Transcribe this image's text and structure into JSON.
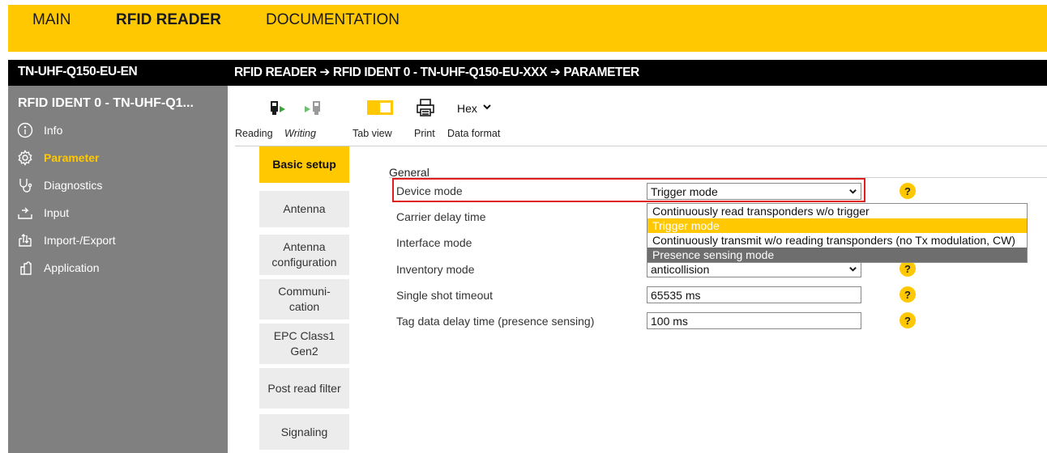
{
  "topnav": {
    "main": "MAIN",
    "rfid": "RFID READER",
    "docs": "DOCUMENTATION"
  },
  "header": {
    "device": "TN-UHF-Q150-EU-EN",
    "breadcrumb": "RFID READER ➔ RFID IDENT 0 - TN-UHF-Q150-EU-XXX ➔ PARAMETER"
  },
  "sidebar": {
    "title": "RFID IDENT 0 - TN-UHF-Q1...",
    "items": [
      {
        "label": "Info",
        "icon": "info-icon"
      },
      {
        "label": "Parameter",
        "icon": "gear-icon",
        "active": true
      },
      {
        "label": "Diagnostics",
        "icon": "stethoscope-icon"
      },
      {
        "label": "Input",
        "icon": "input-icon"
      },
      {
        "label": "Import-/Export",
        "icon": "import-export-icon"
      },
      {
        "label": "Application",
        "icon": "application-icon"
      }
    ]
  },
  "toolbar": {
    "reading": "Reading",
    "writing": "Writing",
    "tabview": "Tab view",
    "print": "Print",
    "dataformat": "Data format",
    "format_value": "Hex"
  },
  "tabs": [
    "Basic setup",
    "Antenna",
    "Antenna configuration",
    "Communi-cation",
    "EPC Class1 Gen2",
    "Post read filter",
    "Signaling"
  ],
  "form": {
    "section": "General",
    "fields": {
      "device_mode": {
        "label": "Device mode",
        "value": "Trigger mode"
      },
      "carrier_delay": {
        "label": "Carrier delay time"
      },
      "interface_mode": {
        "label": "Interface mode"
      },
      "inventory_mode": {
        "label": "Inventory mode",
        "value": "anticollision"
      },
      "single_shot": {
        "label": "Single shot timeout",
        "value": "65535 ms"
      },
      "tag_delay": {
        "label": "Tag data delay time (presence sensing)",
        "value": "100 ms"
      }
    },
    "help": "?"
  },
  "dropdown": {
    "options": [
      "Continuously read transponders w/o trigger",
      "Trigger mode",
      "Continuously transmit w/o reading transponders (no Tx modulation, CW)",
      "Presence sensing mode"
    ]
  },
  "colors": {
    "accent": "#ffc800",
    "sidebar": "#808080",
    "highlight": "#e01e1e"
  }
}
